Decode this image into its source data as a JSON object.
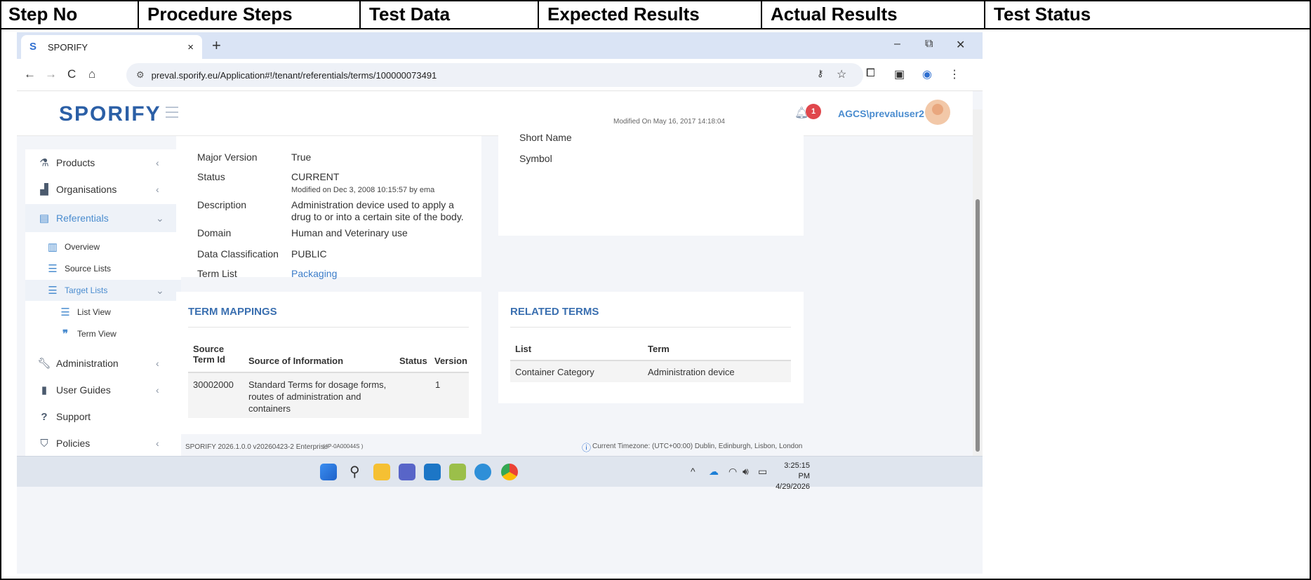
{
  "table_headers": [
    "Step No",
    "Procedure Steps",
    "Test Data",
    "Expected Results",
    "Actual Results",
    "Test Status"
  ],
  "browser": {
    "tab_title": "SPORIFY",
    "tab_close": "×",
    "new_tab": "+",
    "min": "–",
    "restore": "⧉",
    "close": "✕",
    "back": "←",
    "forward": "→",
    "reload": "C",
    "home": "⌂",
    "url": "preval.sporify.eu/Application#!/tenant/referentials/terms/100000073491"
  },
  "app": {
    "logo": "SPORIFY",
    "notif_count": "1",
    "user": "AGCS\\prevaluser2"
  },
  "sidebar": {
    "products": "Products",
    "organisations": "Organisations",
    "referentials": "Referentials",
    "overview": "Overview",
    "source_lists": "Source Lists",
    "target_lists": "Target Lists",
    "list_view": "List View",
    "term_view": "Term View",
    "administration": "Administration",
    "user_guides": "User Guides",
    "support": "Support",
    "policies": "Policies"
  },
  "details": {
    "major_version_label": "Major Version",
    "major_version_value": "True",
    "status_label": "Status",
    "status_value": "CURRENT",
    "status_modified": "Modified on Dec 3, 2008 10:15:57 by ema",
    "description_label": "Description",
    "description_value": "Administration device used to apply a drug to or into a certain site of the body.",
    "domain_label": "Domain",
    "domain_value": "Human and Veterinary use",
    "classification_label": "Data Classification",
    "classification_value": "PUBLIC",
    "termlist_label": "Term List",
    "termlist_value": "Packaging"
  },
  "right_card": {
    "cut_text": "Modified On May 16, 2017 14:18:04",
    "short_name_label": "Short Name",
    "symbol_label": "Symbol"
  },
  "term_mappings": {
    "title": "TERM MAPPINGS",
    "headers": {
      "source_term_id": "Source Term Id",
      "source_info": "Source of Information",
      "status": "Status",
      "version": "Version"
    },
    "row": {
      "id": "30002000",
      "source": "Standard Terms for dosage forms, routes of administration and containers",
      "status": "",
      "version": "1"
    }
  },
  "related_terms": {
    "title": "RELATED TERMS",
    "headers": {
      "list": "List",
      "term": "Term"
    },
    "row": {
      "list": "Container Category",
      "term": "Administration device"
    }
  },
  "footer": {
    "version": "SPORIFY 2026.1.0.0 v20260423-2 Enterprise",
    "build": "( IP-0A00044S )",
    "timezone": "Current Timezone: (UTC+00:00) Dublin, Edinburgh, Lisbon, London"
  },
  "taskbar": {
    "time": "3:25:15 PM",
    "date": "4/29/2026"
  }
}
